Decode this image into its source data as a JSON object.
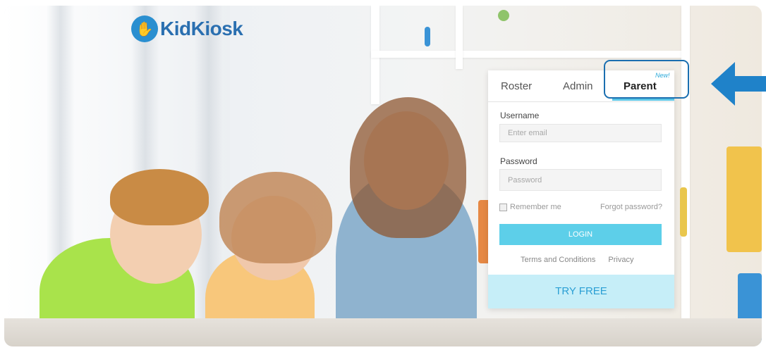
{
  "brand": {
    "name": "KidKiosk",
    "accent": "#2a8fd0"
  },
  "login_panel": {
    "tabs": [
      {
        "label": "Roster"
      },
      {
        "label": "Admin"
      },
      {
        "label": "Parent",
        "badge": "New!",
        "active": true
      }
    ],
    "username": {
      "label": "Username",
      "placeholder": "Enter email"
    },
    "password": {
      "label": "Password",
      "placeholder": "Password"
    },
    "remember_label": "Remember me",
    "forgot_label": "Forgot password?",
    "login_label": "LOGIN",
    "terms_label": "Terms and Conditions",
    "privacy_label": "Privacy",
    "try_free_label": "TRY FREE"
  },
  "annotation": {
    "highlight_color": "#1b6fb0",
    "arrow_color": "#1f82c9",
    "arrow_icon": "arrow-left-icon"
  }
}
